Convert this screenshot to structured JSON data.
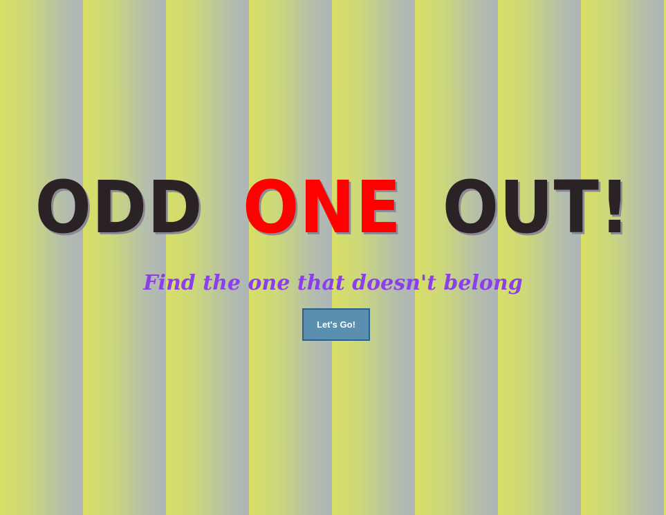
{
  "title": {
    "part1": "ODD",
    "part2": "ONE",
    "part3": "OUT!"
  },
  "subtitle": "Find the one that doesn't belong",
  "start_button_label": "Let's Go!",
  "colors": {
    "title_dark": "#2a2224",
    "title_accent": "#ff0000",
    "subtitle": "#8a3fe8",
    "button_bg": "#5b8fb0",
    "button_border": "#2c5f86",
    "stripe_yellow": "#d8df66",
    "stripe_gray": "#aeb5b8"
  }
}
